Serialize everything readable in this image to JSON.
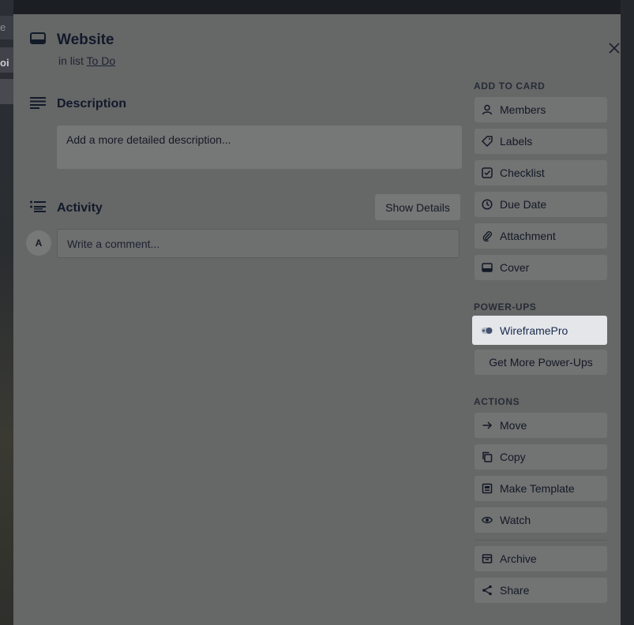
{
  "card": {
    "title": "Website",
    "in_list_prefix": "in list",
    "list_name": "To Do"
  },
  "description": {
    "title": "Description",
    "placeholder": "Add a more detailed description..."
  },
  "activity": {
    "title": "Activity",
    "show_details": "Show Details",
    "avatar_initial": "A",
    "comment_placeholder": "Write a comment..."
  },
  "sidebar": {
    "add_to_card_label": "ADD TO CARD",
    "add_to_card": [
      {
        "label": "Members",
        "icon": "person-icon"
      },
      {
        "label": "Labels",
        "icon": "tag-icon"
      },
      {
        "label": "Checklist",
        "icon": "checklist-icon"
      },
      {
        "label": "Due Date",
        "icon": "clock-icon"
      },
      {
        "label": "Attachment",
        "icon": "paperclip-icon"
      },
      {
        "label": "Cover",
        "icon": "cover-icon"
      }
    ],
    "power_ups_label": "POWER-UPS",
    "power_ups": [
      {
        "label": "WireframePro",
        "icon": "toggle-icon"
      },
      {
        "label": "Get More Power-Ups"
      }
    ],
    "actions_label": "ACTIONS",
    "actions": [
      {
        "label": "Move",
        "icon": "arrow-right-icon"
      },
      {
        "label": "Copy",
        "icon": "copy-icon"
      },
      {
        "label": "Make Template",
        "icon": "template-icon"
      },
      {
        "label": "Watch",
        "icon": "eye-icon"
      },
      {
        "label": "Archive",
        "icon": "archive-icon"
      },
      {
        "label": "Share",
        "icon": "share-icon"
      }
    ]
  },
  "background": {
    "edge_text_1": "e",
    "edge_text_2": "oi"
  },
  "colors": {
    "modal_bg": "#666767",
    "highlight_bg": "#e5e6ea",
    "text_dark": "#11192a"
  }
}
